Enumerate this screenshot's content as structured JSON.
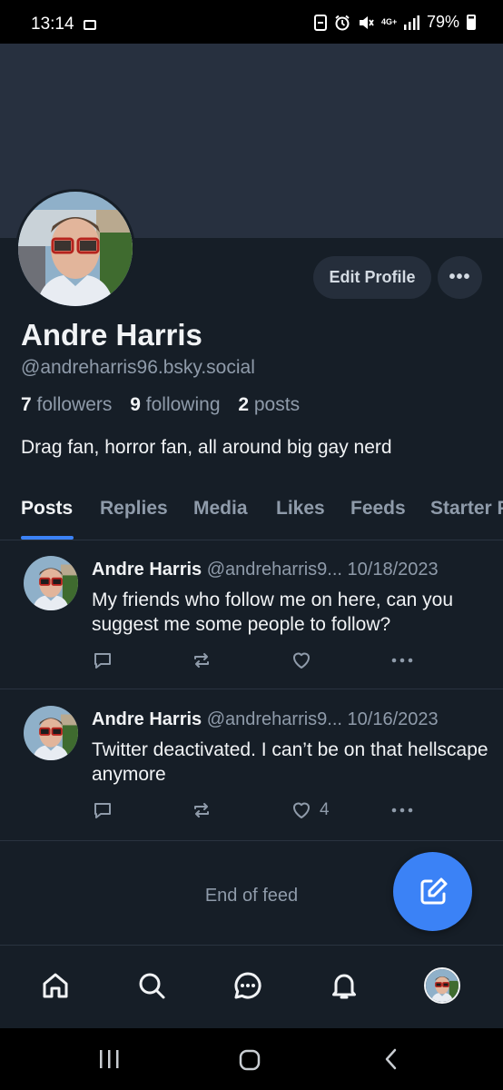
{
  "status_bar": {
    "time": "13:14",
    "network": "4G+",
    "battery": "79%"
  },
  "profile": {
    "display_name": "Andre Harris",
    "handle": "@andreharris96.bsky.social",
    "followers_count": "7",
    "followers_label": "followers",
    "following_count": "9",
    "following_label": "following",
    "posts_count": "2",
    "posts_label": "posts",
    "bio": "Drag fan, horror fan, all around big gay nerd",
    "edit_button": "Edit Profile",
    "more_button": "•••"
  },
  "tabs": [
    {
      "label": "Posts",
      "active": true
    },
    {
      "label": "Replies"
    },
    {
      "label": "Media"
    },
    {
      "label": "Likes"
    },
    {
      "label": "Feeds"
    },
    {
      "label": "Starter P"
    }
  ],
  "posts": [
    {
      "author": "Andre Harris",
      "handle": "@andreharris9...",
      "date": "10/18/2023",
      "text": "My friends who follow me on here, can you suggest me some people to follow?",
      "like_count": ""
    },
    {
      "author": "Andre Harris",
      "handle": "@andreharris9...",
      "date": "10/16/2023",
      "text": "Twitter deactivated. I can’t be on that hellscape anymore",
      "like_count": "4"
    }
  ],
  "feed_end": "End of feed",
  "colors": {
    "background": "#161e27",
    "banner": "#27303f",
    "accent": "#3b82f6",
    "muted": "#8f9baa"
  }
}
